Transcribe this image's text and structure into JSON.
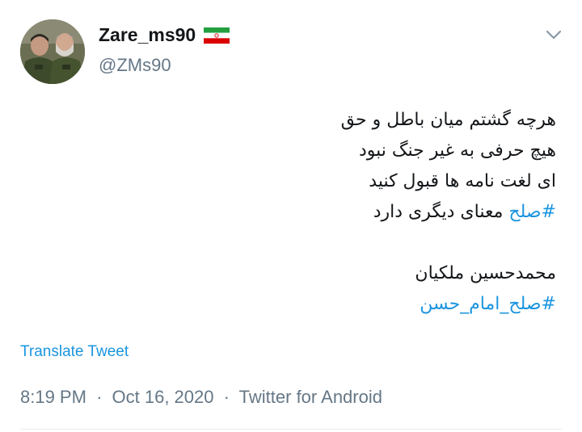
{
  "tweet": {
    "display_name": "Zare_ms90",
    "handle": "@ZMs90",
    "flag_icon": "iran-flag-icon",
    "lines": [
      "هرچه گشتم میان باطل و حق",
      "هیچ حرفی به غیر جنگ نبود",
      "ای لغت نامه ها قبول کنید"
    ],
    "line4_hashtag": "#صلح",
    "line4_rest": " معنای دیگری دارد",
    "author": "محمدحسین ملکیان",
    "hashtag2": "#صلح_امام_حسن",
    "translate_label": "Translate Tweet",
    "time": "8:19 PM",
    "date": "Oct 16, 2020",
    "source": "Twitter for Android",
    "separator": "·",
    "colors": {
      "link": "#1b95e0",
      "secondary": "#657786",
      "text": "#14171a"
    }
  }
}
